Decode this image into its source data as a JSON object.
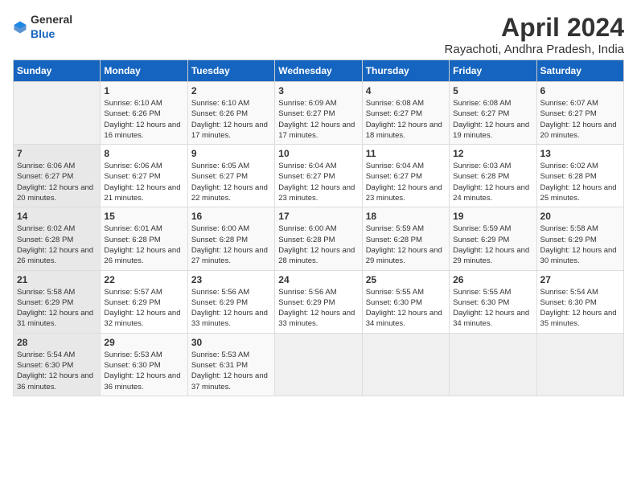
{
  "logo": {
    "general": "General",
    "blue": "Blue"
  },
  "title": "April 2024",
  "subtitle": "Rayachoti, Andhra Pradesh, India",
  "weekdays": [
    "Sunday",
    "Monday",
    "Tuesday",
    "Wednesday",
    "Thursday",
    "Friday",
    "Saturday"
  ],
  "weeks": [
    [
      {
        "day": "",
        "empty": true
      },
      {
        "day": "1",
        "sunrise": "Sunrise: 6:10 AM",
        "sunset": "Sunset: 6:26 PM",
        "daylight": "Daylight: 12 hours and 16 minutes."
      },
      {
        "day": "2",
        "sunrise": "Sunrise: 6:10 AM",
        "sunset": "Sunset: 6:26 PM",
        "daylight": "Daylight: 12 hours and 17 minutes."
      },
      {
        "day": "3",
        "sunrise": "Sunrise: 6:09 AM",
        "sunset": "Sunset: 6:27 PM",
        "daylight": "Daylight: 12 hours and 17 minutes."
      },
      {
        "day": "4",
        "sunrise": "Sunrise: 6:08 AM",
        "sunset": "Sunset: 6:27 PM",
        "daylight": "Daylight: 12 hours and 18 minutes."
      },
      {
        "day": "5",
        "sunrise": "Sunrise: 6:08 AM",
        "sunset": "Sunset: 6:27 PM",
        "daylight": "Daylight: 12 hours and 19 minutes."
      },
      {
        "day": "6",
        "sunrise": "Sunrise: 6:07 AM",
        "sunset": "Sunset: 6:27 PM",
        "daylight": "Daylight: 12 hours and 20 minutes."
      }
    ],
    [
      {
        "day": "7",
        "sunrise": "Sunrise: 6:06 AM",
        "sunset": "Sunset: 6:27 PM",
        "daylight": "Daylight: 12 hours and 20 minutes."
      },
      {
        "day": "8",
        "sunrise": "Sunrise: 6:06 AM",
        "sunset": "Sunset: 6:27 PM",
        "daylight": "Daylight: 12 hours and 21 minutes."
      },
      {
        "day": "9",
        "sunrise": "Sunrise: 6:05 AM",
        "sunset": "Sunset: 6:27 PM",
        "daylight": "Daylight: 12 hours and 22 minutes."
      },
      {
        "day": "10",
        "sunrise": "Sunrise: 6:04 AM",
        "sunset": "Sunset: 6:27 PM",
        "daylight": "Daylight: 12 hours and 23 minutes."
      },
      {
        "day": "11",
        "sunrise": "Sunrise: 6:04 AM",
        "sunset": "Sunset: 6:27 PM",
        "daylight": "Daylight: 12 hours and 23 minutes."
      },
      {
        "day": "12",
        "sunrise": "Sunrise: 6:03 AM",
        "sunset": "Sunset: 6:28 PM",
        "daylight": "Daylight: 12 hours and 24 minutes."
      },
      {
        "day": "13",
        "sunrise": "Sunrise: 6:02 AM",
        "sunset": "Sunset: 6:28 PM",
        "daylight": "Daylight: 12 hours and 25 minutes."
      }
    ],
    [
      {
        "day": "14",
        "sunrise": "Sunrise: 6:02 AM",
        "sunset": "Sunset: 6:28 PM",
        "daylight": "Daylight: 12 hours and 26 minutes."
      },
      {
        "day": "15",
        "sunrise": "Sunrise: 6:01 AM",
        "sunset": "Sunset: 6:28 PM",
        "daylight": "Daylight: 12 hours and 26 minutes."
      },
      {
        "day": "16",
        "sunrise": "Sunrise: 6:00 AM",
        "sunset": "Sunset: 6:28 PM",
        "daylight": "Daylight: 12 hours and 27 minutes."
      },
      {
        "day": "17",
        "sunrise": "Sunrise: 6:00 AM",
        "sunset": "Sunset: 6:28 PM",
        "daylight": "Daylight: 12 hours and 28 minutes."
      },
      {
        "day": "18",
        "sunrise": "Sunrise: 5:59 AM",
        "sunset": "Sunset: 6:28 PM",
        "daylight": "Daylight: 12 hours and 29 minutes."
      },
      {
        "day": "19",
        "sunrise": "Sunrise: 5:59 AM",
        "sunset": "Sunset: 6:29 PM",
        "daylight": "Daylight: 12 hours and 29 minutes."
      },
      {
        "day": "20",
        "sunrise": "Sunrise: 5:58 AM",
        "sunset": "Sunset: 6:29 PM",
        "daylight": "Daylight: 12 hours and 30 minutes."
      }
    ],
    [
      {
        "day": "21",
        "sunrise": "Sunrise: 5:58 AM",
        "sunset": "Sunset: 6:29 PM",
        "daylight": "Daylight: 12 hours and 31 minutes."
      },
      {
        "day": "22",
        "sunrise": "Sunrise: 5:57 AM",
        "sunset": "Sunset: 6:29 PM",
        "daylight": "Daylight: 12 hours and 32 minutes."
      },
      {
        "day": "23",
        "sunrise": "Sunrise: 5:56 AM",
        "sunset": "Sunset: 6:29 PM",
        "daylight": "Daylight: 12 hours and 33 minutes."
      },
      {
        "day": "24",
        "sunrise": "Sunrise: 5:56 AM",
        "sunset": "Sunset: 6:29 PM",
        "daylight": "Daylight: 12 hours and 33 minutes."
      },
      {
        "day": "25",
        "sunrise": "Sunrise: 5:55 AM",
        "sunset": "Sunset: 6:30 PM",
        "daylight": "Daylight: 12 hours and 34 minutes."
      },
      {
        "day": "26",
        "sunrise": "Sunrise: 5:55 AM",
        "sunset": "Sunset: 6:30 PM",
        "daylight": "Daylight: 12 hours and 34 minutes."
      },
      {
        "day": "27",
        "sunrise": "Sunrise: 5:54 AM",
        "sunset": "Sunset: 6:30 PM",
        "daylight": "Daylight: 12 hours and 35 minutes."
      }
    ],
    [
      {
        "day": "28",
        "sunrise": "Sunrise: 5:54 AM",
        "sunset": "Sunset: 6:30 PM",
        "daylight": "Daylight: 12 hours and 36 minutes."
      },
      {
        "day": "29",
        "sunrise": "Sunrise: 5:53 AM",
        "sunset": "Sunset: 6:30 PM",
        "daylight": "Daylight: 12 hours and 36 minutes."
      },
      {
        "day": "30",
        "sunrise": "Sunrise: 5:53 AM",
        "sunset": "Sunset: 6:31 PM",
        "daylight": "Daylight: 12 hours and 37 minutes."
      },
      {
        "day": "",
        "empty": true
      },
      {
        "day": "",
        "empty": true
      },
      {
        "day": "",
        "empty": true
      },
      {
        "day": "",
        "empty": true
      }
    ]
  ]
}
